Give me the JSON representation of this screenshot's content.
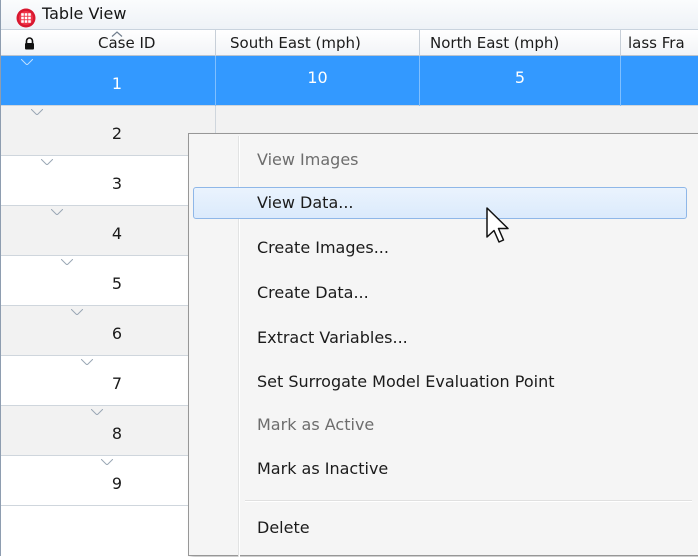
{
  "window": {
    "title": "Table View"
  },
  "columns": {
    "case_id": "Case ID",
    "south_east": "South East (mph)",
    "north_east": "North East (mph)",
    "partial": "lass Fra"
  },
  "rows": [
    {
      "id": "1",
      "south_east": "10",
      "north_east": "5"
    },
    {
      "id": "2"
    },
    {
      "id": "3"
    },
    {
      "id": "4"
    },
    {
      "id": "5"
    },
    {
      "id": "6"
    },
    {
      "id": "7"
    },
    {
      "id": "8"
    },
    {
      "id": "9"
    }
  ],
  "context_menu": {
    "items": [
      {
        "label": "View Images",
        "enabled": false
      },
      {
        "label": "View Data...",
        "enabled": true,
        "hovered": true
      },
      {
        "label": "Create Images...",
        "enabled": true
      },
      {
        "label": "Create Data...",
        "enabled": true
      },
      {
        "label": "Extract Variables...",
        "enabled": true
      },
      {
        "label": "Set Surrogate Model Evaluation Point",
        "enabled": true
      },
      {
        "label": "Mark as Active",
        "enabled": false
      },
      {
        "label": "Mark as Inactive",
        "enabled": true
      },
      {
        "label": "Delete",
        "enabled": true
      }
    ]
  },
  "colors": {
    "selection": "#3399ff",
    "menu_background": "#f5f5f5",
    "hover_border": "#8fb7e8",
    "app_icon": "#e0203a"
  },
  "icons": {
    "app": "table-grid-icon",
    "lock": "lock-icon",
    "sort": "sort-ascending-icon",
    "cursor": "mouse-pointer-icon"
  }
}
